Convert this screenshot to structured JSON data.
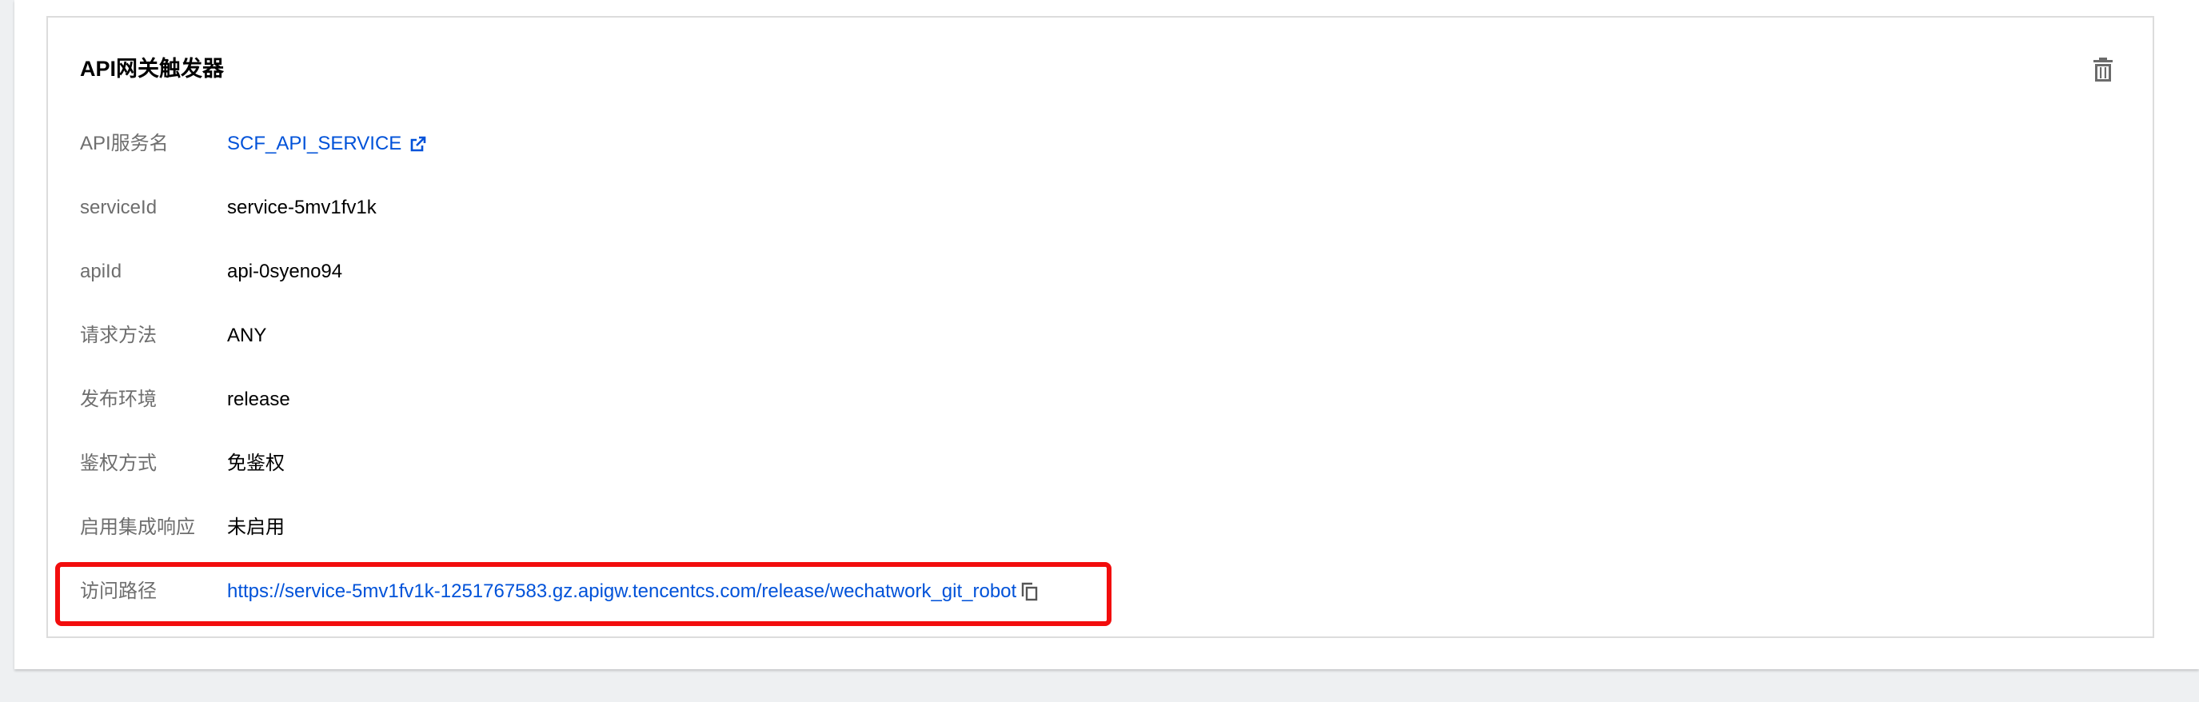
{
  "card": {
    "title": "API网关触发器"
  },
  "fields": [
    {
      "label": "API服务名",
      "value": "SCF_API_SERVICE"
    },
    {
      "label": "serviceId",
      "value": "service-5mv1fv1k"
    },
    {
      "label": "apiId",
      "value": "api-0syeno94"
    },
    {
      "label": "请求方法",
      "value": "ANY"
    },
    {
      "label": "发布环境",
      "value": "release"
    },
    {
      "label": "鉴权方式",
      "value": "免鉴权"
    },
    {
      "label": "启用集成响应",
      "value": "未启用"
    },
    {
      "label": "访问路径",
      "value": "https://service-5mv1fv1k-1251767583.gz.apigw.tencentcs.com/release/wechatwork_git_robot"
    }
  ],
  "icons": {
    "delete": "trash-icon",
    "external_link": "external-link-icon",
    "copy": "copy-icon"
  },
  "colors": {
    "link": "#0052d9",
    "label": "#6e6e6e",
    "highlight": "#f20d0d",
    "background": "#eef0f2"
  }
}
